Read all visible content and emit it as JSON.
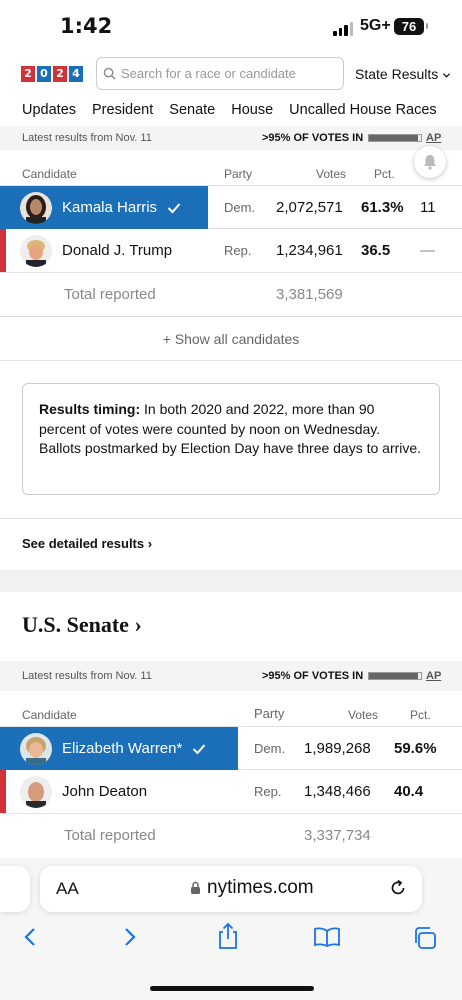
{
  "status": {
    "time": "1:42",
    "network": "5G+",
    "battery": "76"
  },
  "header": {
    "logo_digits": [
      "2",
      "0",
      "2",
      "4"
    ],
    "logo_colors": [
      "#d03238",
      "#1a6fb8",
      "#d03238",
      "#1a6fb8"
    ],
    "search_placeholder": "Search for a race or candidate",
    "state_results": "State Results",
    "tabs": [
      "Updates",
      "President",
      "Senate",
      "House",
      "Uncalled House Races"
    ]
  },
  "president": {
    "updated": "Latest results from Nov. 11",
    "votes_in": ">95% OF VOTES IN",
    "votes_in_fraction": 0.95,
    "source": "AP",
    "columns": {
      "candidate": "Candidate",
      "party": "Party",
      "votes": "Votes",
      "pct": "Pct."
    },
    "rows": [
      {
        "name": "Kamala Harris",
        "party": "Dem.",
        "votes": "2,072,571",
        "pct": "61.3%",
        "ev": "11",
        "winner": true
      },
      {
        "name": "Donald J. Trump",
        "party": "Rep.",
        "votes": "1,234,961",
        "pct": "36.5",
        "ev": "—",
        "winner": false
      }
    ],
    "total_label": "Total reported",
    "total_votes": "3,381,569",
    "show_all": "+ Show all candidates"
  },
  "notice": {
    "bold": "Results timing:",
    "text": " In both 2020 and 2022, more than 90 percent of votes were counted by noon on Wednesday. Ballots postmarked by Election Day have three days to arrive."
  },
  "detail_link": "See detailed results ›",
  "senate": {
    "title": "U.S. Senate ›",
    "updated": "Latest results from Nov. 11",
    "votes_in": ">95% OF VOTES IN",
    "source": "AP",
    "columns": {
      "candidate": "Candidate",
      "party": "Party",
      "votes": "Votes",
      "pct": "Pct."
    },
    "rows": [
      {
        "name": "Elizabeth Warren*",
        "party": "Dem.",
        "votes": "1,989,268",
        "pct": "59.6%",
        "winner": true
      },
      {
        "name": "John Deaton",
        "party": "Rep.",
        "votes": "1,348,466",
        "pct": "40.4",
        "winner": false
      }
    ],
    "total_label": "Total reported",
    "total_votes": "3,337,734"
  },
  "browser": {
    "aa": "AA",
    "url": "nytimes.com"
  }
}
